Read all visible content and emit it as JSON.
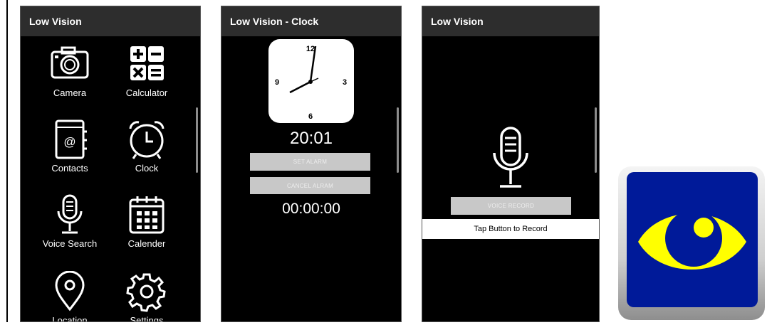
{
  "home": {
    "title": "Low Vision",
    "tiles": [
      {
        "label": "Camera",
        "icon": "camera-icon"
      },
      {
        "label": "Calculator",
        "icon": "calculator-icon"
      },
      {
        "label": "Contacts",
        "icon": "contacts-icon"
      },
      {
        "label": "Clock",
        "icon": "alarm-clock-icon"
      },
      {
        "label": "Voice Search",
        "icon": "microphone-icon"
      },
      {
        "label": "Calender",
        "icon": "calendar-icon"
      },
      {
        "label": "Location",
        "icon": "location-pin-icon"
      },
      {
        "label": "Settings",
        "icon": "gear-icon"
      }
    ]
  },
  "clock": {
    "title": "Low Vision - Clock",
    "dial": {
      "n12": "12",
      "n3": "3",
      "n6": "6",
      "n9": "9"
    },
    "time": "20:01",
    "set_alarm": "SET ALARM",
    "cancel_alarm": "CANCEL ALRAM",
    "timer": "00:00:00"
  },
  "voice": {
    "title": "Low Vision",
    "button": "VOICE RECORD",
    "status": "Tap Button to Record"
  },
  "app_icon": {
    "name": "eye-icon",
    "colors": {
      "background": "#001a99",
      "eye": "#ffff00",
      "pupil": "#001a99"
    }
  }
}
